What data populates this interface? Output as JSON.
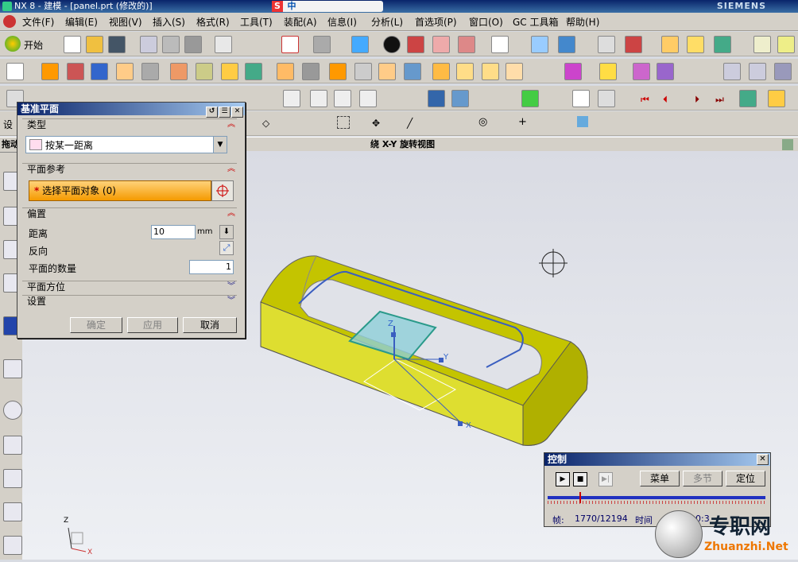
{
  "window": {
    "title": "NX 8 - 建模 - [panel.prt (修改的)]",
    "brand": "SIEMENS",
    "ime_char": "中"
  },
  "menubar": {
    "items": [
      "文件(F)",
      "编辑(E)",
      "视图(V)",
      "插入(S)",
      "格式(R)",
      "工具(T)",
      "装配(A)",
      "信息(I)",
      "分析(L)",
      "首选项(P)",
      "窗口(O)",
      "GC 工具箱",
      "帮助(H)"
    ]
  },
  "toolbar": {
    "start_label": "开始"
  },
  "left_strip_label": "设",
  "statusbar": {
    "left": "拖动",
    "center": "绕 X-Y 旋转视图"
  },
  "dialog": {
    "title": "基准平面",
    "type_section": "类型",
    "type_value": "按某一距离",
    "ref_section": "平面参考",
    "ref_select": "选择平面对象 (0)",
    "offset_section": "偏置",
    "distance_label": "距离",
    "distance_value": "10",
    "distance_unit": "mm",
    "reverse_label": "反向",
    "count_label": "平面的数量",
    "count_value": "1",
    "orientation_section": "平面方位",
    "settings_section": "设置",
    "ok": "确定",
    "apply": "应用",
    "cancel": "取消"
  },
  "control": {
    "title": "控制",
    "menu": "菜单",
    "multi": "多节",
    "locate": "定位",
    "frame_label": "帧:",
    "frame_value": "1770/12194",
    "time_label": "时间",
    "time_value": "0:3"
  },
  "axes": {
    "x": "X",
    "y": "Y",
    "z": "Z"
  },
  "watermark": {
    "cn": "专职网",
    "en": "Zhuanzhi.Net"
  },
  "colors": {
    "title_blue": "#0a246a",
    "model_yellow": "#d6d600",
    "select_orange": "#f59a00",
    "plane_cyan": "#8fd0d8"
  }
}
